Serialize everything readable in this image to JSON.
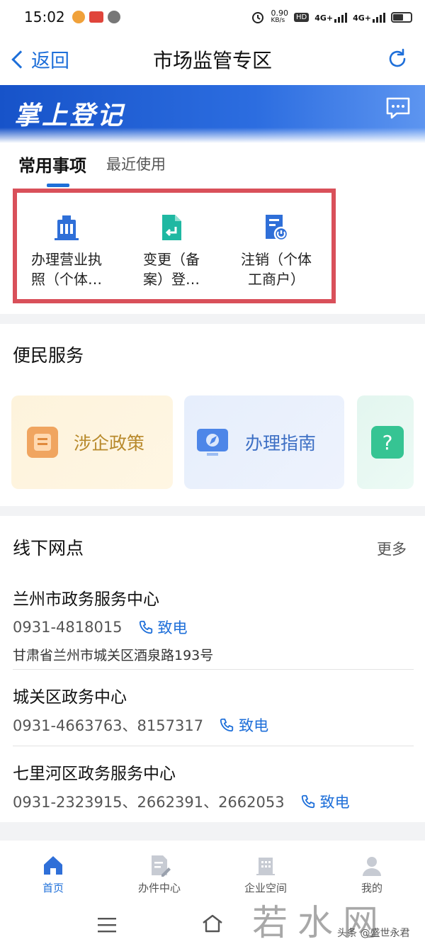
{
  "status_bar": {
    "time": "15:02",
    "net_speed_value": "0.90",
    "net_speed_unit": "KB/s",
    "hd_label": "HD",
    "network_1": "4G+",
    "network_2": "4G+"
  },
  "nav": {
    "back_label": "返回",
    "title": "市场监管专区"
  },
  "banner": {
    "title": "掌上登记"
  },
  "tabs": {
    "items": [
      {
        "label": "常用事项",
        "active": true
      },
      {
        "label": "最近使用",
        "active": false
      }
    ]
  },
  "common_items": [
    {
      "line1": "办理营业执",
      "line2": "照（个体…",
      "icon": "building-icon",
      "color": "#2f6fd8"
    },
    {
      "line1": "变更（备",
      "line2": "案）登…",
      "icon": "document-return-icon",
      "color": "#1fb8a2"
    },
    {
      "line1": "注销（个体",
      "line2": "工商户）",
      "icon": "cancel-document-icon",
      "color": "#2f6fd8"
    }
  ],
  "services": {
    "title": "便民服务",
    "cards": [
      {
        "label": "涉企政策",
        "icon": "policy-icon"
      },
      {
        "label": "办理指南",
        "icon": "guide-compass-icon"
      },
      {
        "label": "?",
        "icon": "help-question-icon"
      }
    ]
  },
  "offline": {
    "title": "线下网点",
    "more_label": "更多",
    "call_label": "致电",
    "sites": [
      {
        "name": "兰州市政务服务中心",
        "phone": "0931-4818015",
        "address": "甘肃省兰州市城关区酒泉路193号"
      },
      {
        "name": "城关区政务中心",
        "phone": "0931-4663763、8157317",
        "address": ""
      },
      {
        "name": "七里河区政务服务中心",
        "phone": "0931-2323915、2662391、2662053",
        "address": ""
      }
    ]
  },
  "bottom_nav": {
    "items": [
      {
        "label": "首页",
        "icon": "home-icon",
        "active": true
      },
      {
        "label": "办件中心",
        "icon": "task-center-icon",
        "active": false
      },
      {
        "label": "企业空间",
        "icon": "enterprise-building-icon",
        "active": false
      },
      {
        "label": "我的",
        "icon": "profile-icon",
        "active": false
      }
    ]
  },
  "watermark": {
    "text": "若水网",
    "credit": "头条 @盛世永君"
  },
  "colors": {
    "accent": "#1e6fd9",
    "highlight_border": "#d9505a",
    "banner_blue": "#1753c9"
  }
}
